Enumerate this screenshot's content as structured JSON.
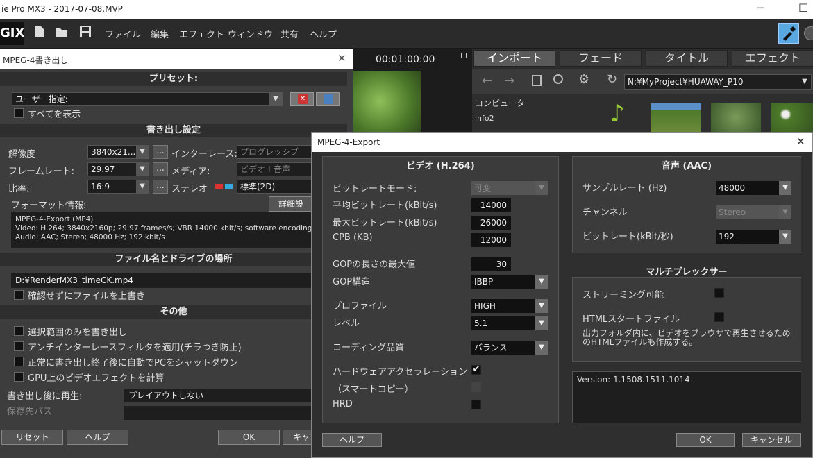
{
  "app": {
    "title": "ie Pro MX3 - 2017-07-08.MVP",
    "logo": "GIX",
    "minimize": "─",
    "maximize": "☐"
  },
  "menu": [
    "ファイル",
    "編集",
    "エフェクト",
    "ウィンドウ",
    "共有",
    "ヘルプ"
  ],
  "left_dialog": {
    "title": "MPEG-4書き出し",
    "close": "✕",
    "preset_head": "プリセット:",
    "preset_value": "ユーザー指定:",
    "show_all": "すべてを表示",
    "export_head": "書き出し設定",
    "resolution_label": "解像度",
    "resolution_value": "3840x21...",
    "interlace_label": "インターレース:",
    "interlace_value": "プログレッシブ",
    "framerate_label": "フレームレート:",
    "framerate_value": "29.97",
    "media_label": "メディア:",
    "media_value": "ビデオ＋音声",
    "ratio_label": "比率:",
    "ratio_value": "16:9",
    "stereo_label": "ステレオ",
    "stereo_value": "標準(2D)",
    "format_label": "フォーマット情報:",
    "detail_btn": "詳細設",
    "format_lines": [
      "MPEG-4-Export (MP4)",
      "Video: H.264; 3840x2160p; 29.97 frames/s; VBR 14000 kbit/s; software encoding",
      "Audio: AAC; Stereo; 48000 Hz; 192 kbit/s"
    ],
    "file_head": "ファイル名とドライブの場所",
    "file_path": "D:¥RenderMX3_timeCK.mp4",
    "overwrite": "確認せずにファイルを上書き",
    "other_head": "その他",
    "options": [
      "選択範囲のみを書き出し",
      "アンチインターレースフィルタを適用(チラつき防止)",
      "正常に書き出し終了後に自動でPCをシャットダウン",
      "GPU上のビデオエフェクトを計算"
    ],
    "play_label": "書き出し後に再生:",
    "play_value": "プレイアウトしない",
    "save_label": "保存先パス",
    "reset_btn": "リセット",
    "help_btn": "ヘルプ",
    "ok_btn": "OK",
    "cancel_btn": "キャ"
  },
  "preview": {
    "timecode": "00:01:00:00"
  },
  "right_panel": {
    "tabs": [
      "インポート",
      "フェード",
      "タイトル",
      "エフェクト"
    ],
    "path": "N:¥MyProject¥HUAWAY_P10",
    "tree": [
      "コンピュータ",
      "info2"
    ]
  },
  "mpeg_dialog": {
    "title": "MPEG-4-Export",
    "close": "✕",
    "video_head": "ビデオ (H.264)",
    "bitrate_mode_label": "ビットレートモード:",
    "bitrate_mode_value": "可変",
    "avg_label": "平均ビットレート(kBit/s)",
    "avg_value": "14000",
    "max_label": "最大ビットレート(kBit/s)",
    "max_value": "26000",
    "cpb_label": "CPB (KB)",
    "cpb_value": "12000",
    "gop_max_label": "GOPの長さの最大値",
    "gop_max_value": "30",
    "gop_struct_label": "GOP構造",
    "gop_struct_value": "IBBP",
    "profile_label": "プロファイル",
    "profile_value": "HIGH",
    "level_label": "レベル",
    "level_value": "5.1",
    "quality_label": "コーディング品質",
    "quality_value": "バランス",
    "hw_label": "ハードウェアアクセラレーション",
    "hw_check": "✔",
    "smart_label": "（スマートコピー）",
    "hrd_label": "HRD",
    "audio_head": "音声 (AAC)",
    "samplerate_label": "サンプルレート (Hz)",
    "samplerate_value": "48000",
    "channel_label": "チャンネル",
    "channel_value": "Stereo",
    "audio_bitrate_label": "ビットレート(kBit/秒)",
    "audio_bitrate_value": "192",
    "mux_head": "マルチプレックサー",
    "streaming_label": "ストリーミング可能",
    "html_label": "HTMLスタートファイル",
    "html_desc": "出力フォルダ内に、ビデオをブラウザで再生させるためのHTMLファイルも作成する。",
    "version": "Version: 1.1508.1511.1014",
    "help_btn": "ヘルプ",
    "ok_btn": "OK",
    "cancel_btn": "キャンセル"
  }
}
